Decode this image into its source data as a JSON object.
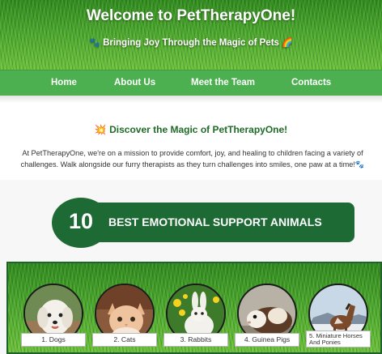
{
  "header": {
    "title": "Welcome to PetTherapyOne!",
    "subtitle_emoji_left": "🐾",
    "subtitle": "Bringing Joy Through the Magic of Pets",
    "subtitle_emoji_right": "🌈"
  },
  "nav": {
    "items": [
      {
        "label": "Home"
      },
      {
        "label": "About Us"
      },
      {
        "label": "Meet the Team"
      },
      {
        "label": "Contacts"
      }
    ]
  },
  "intro": {
    "emoji": "💥",
    "heading": "Discover the Magic of PetTherapyOne!",
    "line1": "At PetTherapyOne, we're on a mission to provide comfort, joy, and healing to children facing a variety of",
    "line2": "challenges. Walk alongside our furry therapists as they turn challenges into smiles, one paw at a time!",
    "line2_emoji": "🐾"
  },
  "banner": {
    "number": "10",
    "title": "BEST EMOTIONAL SUPPORT ANIMALS"
  },
  "animals": [
    {
      "label": "1. Dogs",
      "icon": "dog-photo"
    },
    {
      "label": "2. Cats",
      "icon": "cat-photo"
    },
    {
      "label": "3. Rabbits",
      "icon": "rabbit-photo"
    },
    {
      "label": "4. Guinea Pigs",
      "icon": "guinea-pig-photo"
    },
    {
      "label": "5. Miniature Horses And Ponies",
      "icon": "horse-photo"
    }
  ],
  "colors": {
    "nav": "#4caf50",
    "brand_green": "#1e6a35",
    "heading_green": "#1f6b27"
  }
}
